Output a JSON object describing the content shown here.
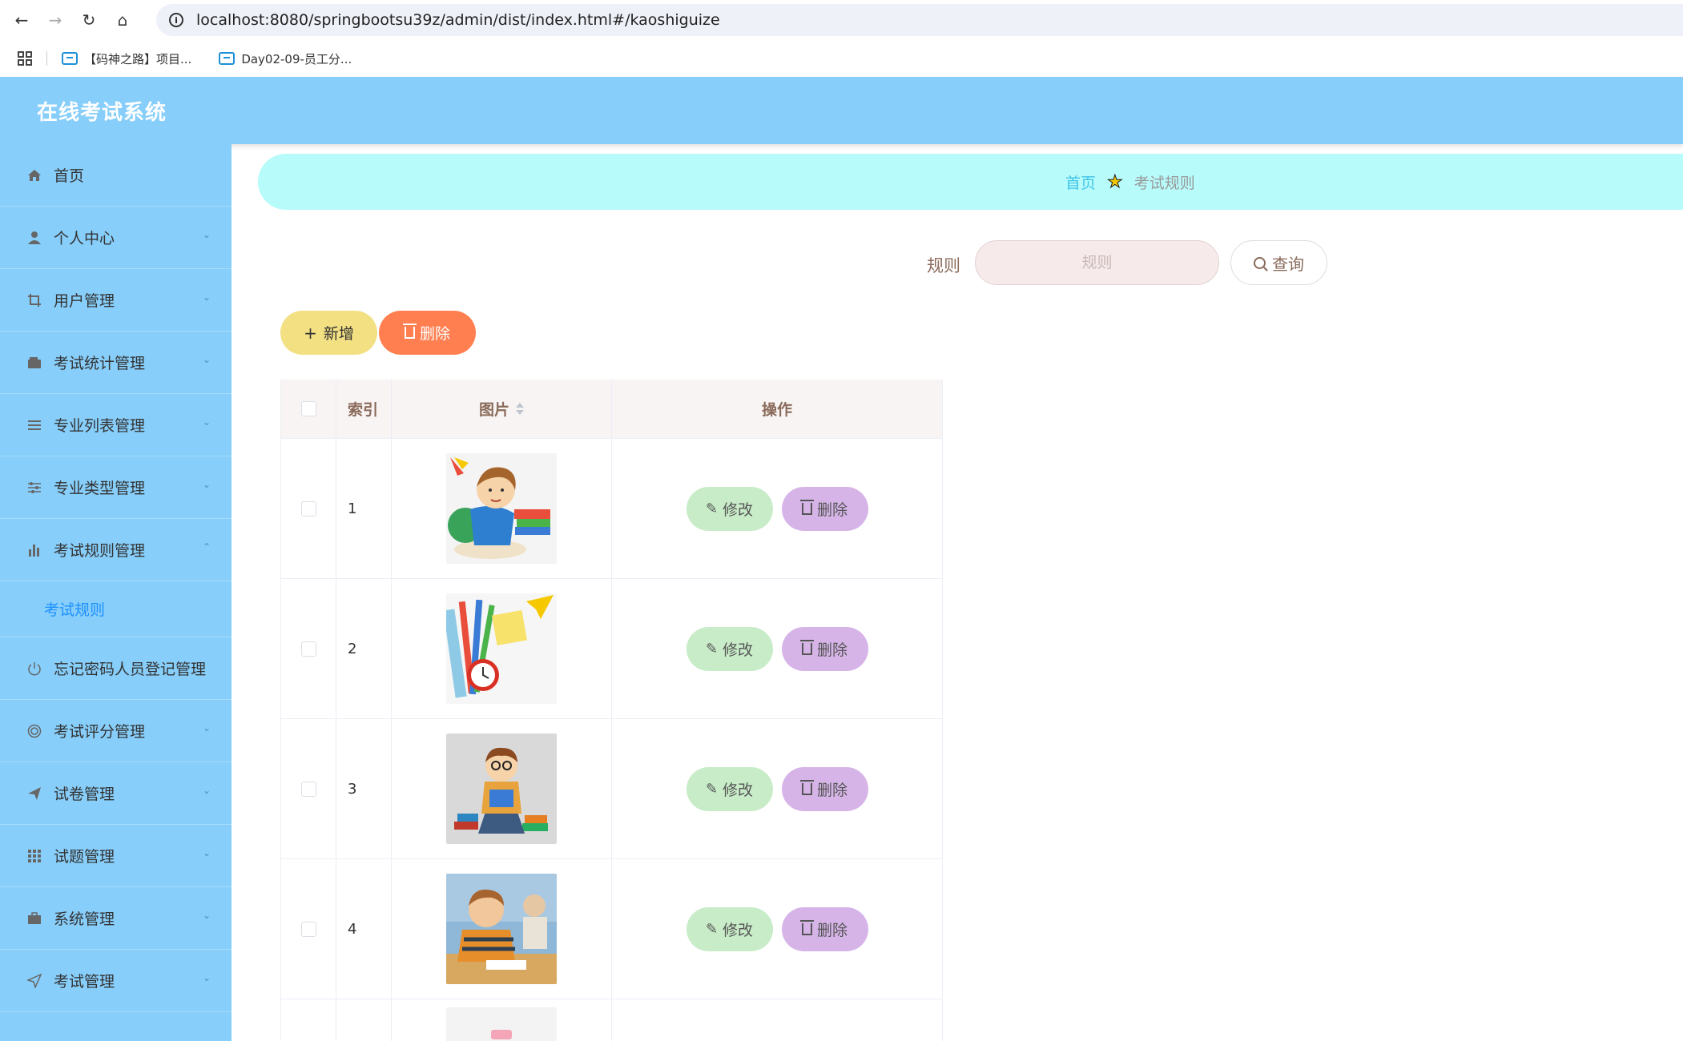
{
  "browser": {
    "url": "localhost:8080/springbootsu39z/admin/dist/index.html#/kaoshiguize",
    "bookmarks": [
      {
        "label": "【码神之路】项目..."
      },
      {
        "label": "Day02-09-员工分..."
      }
    ]
  },
  "app": {
    "title": "在线考试系统"
  },
  "sidebar": {
    "items": [
      {
        "label": "首页",
        "icon": "home-icon"
      },
      {
        "label": "个人中心",
        "icon": "user-icon"
      },
      {
        "label": "用户管理",
        "icon": "crop-icon"
      },
      {
        "label": "考试统计管理",
        "icon": "wallet-icon"
      },
      {
        "label": "专业列表管理",
        "icon": "list-icon"
      },
      {
        "label": "专业类型管理",
        "icon": "sliders-icon"
      },
      {
        "label": "考试规则管理",
        "icon": "bar-chart-icon"
      },
      {
        "label": "考试规则",
        "icon": ""
      },
      {
        "label": "忘记密码人员登记管理",
        "icon": "power-icon"
      },
      {
        "label": "考试评分管理",
        "icon": "target-icon"
      },
      {
        "label": "试卷管理",
        "icon": "paper-plane-icon"
      },
      {
        "label": "试题管理",
        "icon": "grid-icon"
      },
      {
        "label": "系统管理",
        "icon": "briefcase-icon"
      },
      {
        "label": "考试管理",
        "icon": "send-icon"
      }
    ]
  },
  "breadcrumb": {
    "home": "首页",
    "current": "考试规则"
  },
  "search": {
    "label": "规则",
    "placeholder": "规则",
    "button": "查询"
  },
  "toolbar": {
    "add_label": "新增",
    "delete_label": "删除"
  },
  "table": {
    "headers": {
      "index": "索引",
      "image": "图片",
      "actions": "操作"
    },
    "rows": [
      {
        "index": "1",
        "edit": "修改",
        "delete": "删除"
      },
      {
        "index": "2",
        "edit": "修改",
        "delete": "删除"
      },
      {
        "index": "3",
        "edit": "修改",
        "delete": "删除"
      },
      {
        "index": "4",
        "edit": "修改",
        "delete": "删除"
      }
    ]
  }
}
